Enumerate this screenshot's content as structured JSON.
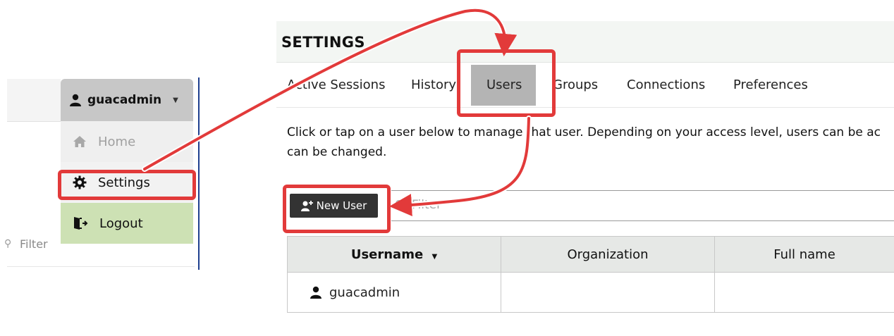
{
  "left_panel": {
    "user_menu": {
      "username": "guacadmin",
      "items": [
        {
          "label": "Home",
          "icon": "home-icon"
        },
        {
          "label": "Settings",
          "icon": "gear-icon"
        },
        {
          "label": "Logout",
          "icon": "logout-icon"
        }
      ]
    },
    "filter_placeholder": "Filter"
  },
  "settings": {
    "title": "SETTINGS",
    "tabs": [
      "Active Sessions",
      "History",
      "Users",
      "Groups",
      "Connections",
      "Preferences"
    ],
    "active_tab": "Users",
    "description_line1": "Click or tap on a user below to manage that user. Depending on your access level, users can be ac",
    "description_line2": "can be changed.",
    "new_user_label": "New User",
    "filter_placeholder": "Filter",
    "table": {
      "columns": [
        "Username",
        "Organization",
        "Full name"
      ],
      "sorted_column": "Username",
      "rows": [
        {
          "username": "guacadmin",
          "organization": "",
          "full_name": ""
        }
      ]
    }
  },
  "colors": {
    "highlight": "#e23a3a",
    "active_tab": "#b4b4b4",
    "logout_bg": "#cde1b4",
    "button_dark": "#333333"
  }
}
